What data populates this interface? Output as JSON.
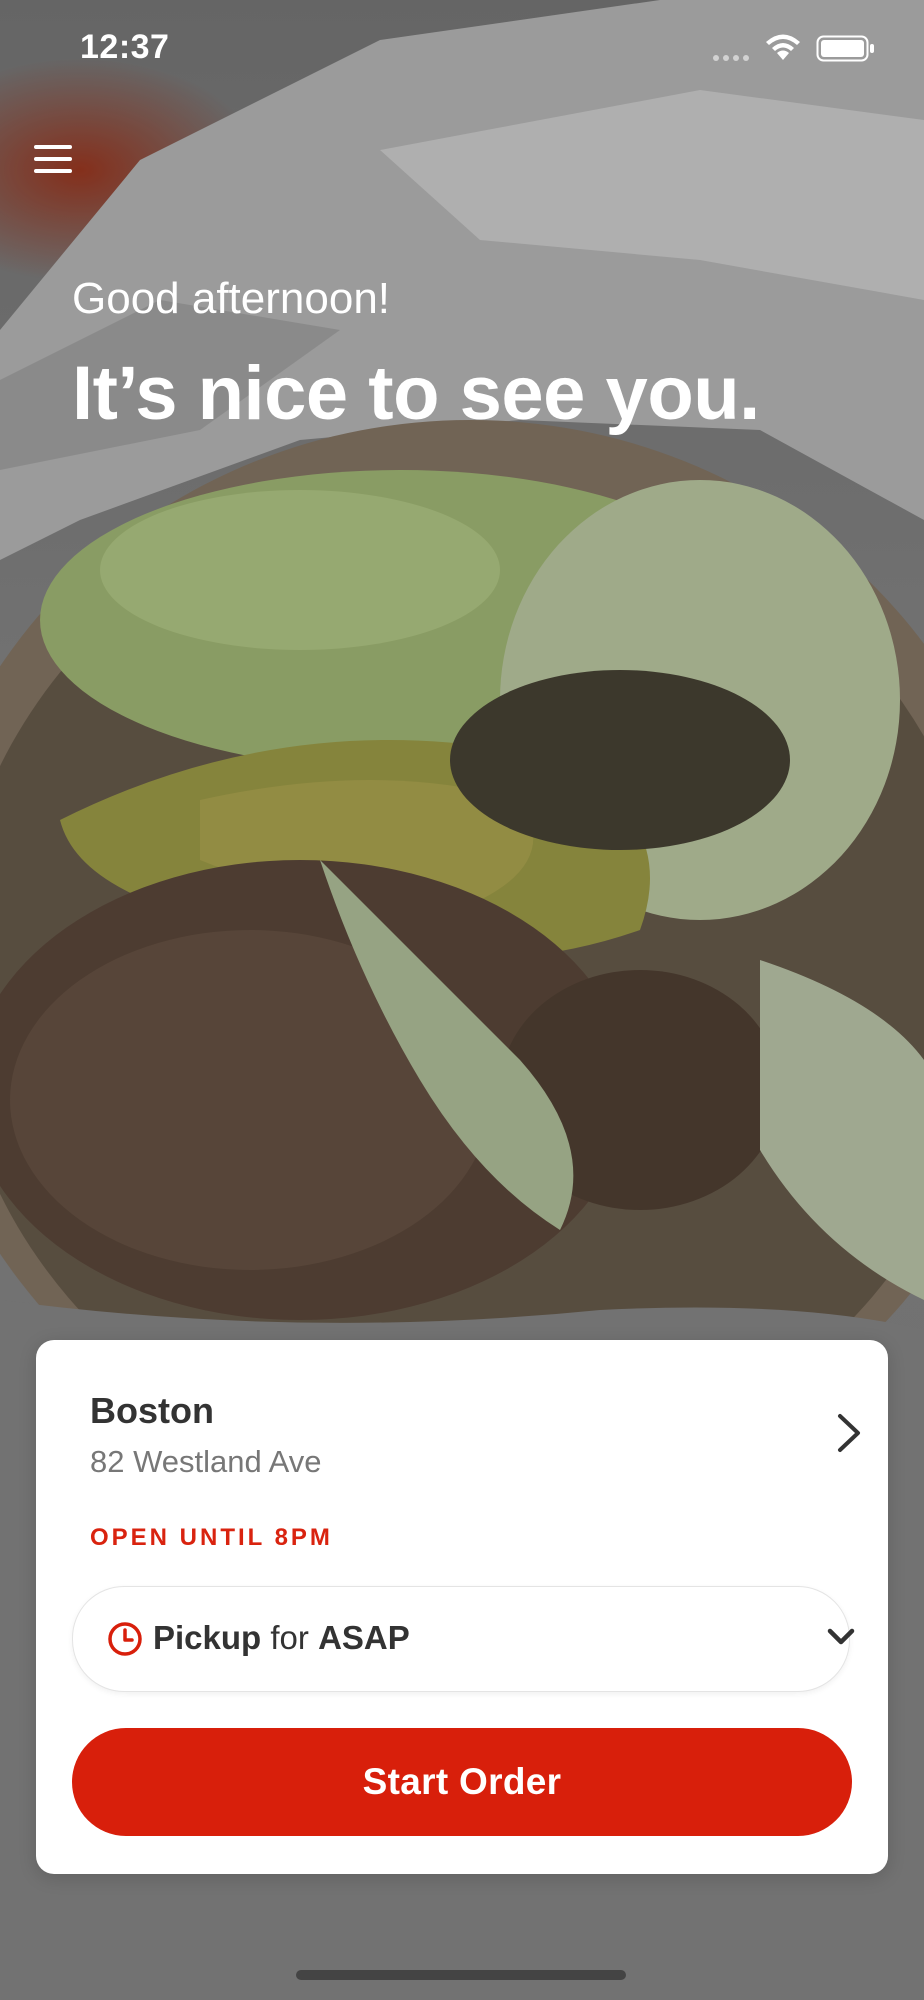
{
  "status_bar": {
    "time": "12:37"
  },
  "header": {
    "menu_icon": "hamburger-menu-icon",
    "greeting": "Good afternoon!",
    "headline": "It’s nice to see you."
  },
  "location_card": {
    "city": "Boston",
    "address": "82 Westland Ave",
    "hours": "OPEN UNTIL 8PM",
    "pickup": {
      "mode": "Pickup",
      "connector": "for",
      "time": "ASAP",
      "icon": "clock-icon"
    },
    "start_button_label": "Start Order"
  },
  "colors": {
    "accent": "#d81f0b",
    "hours_text": "#d9230f"
  }
}
